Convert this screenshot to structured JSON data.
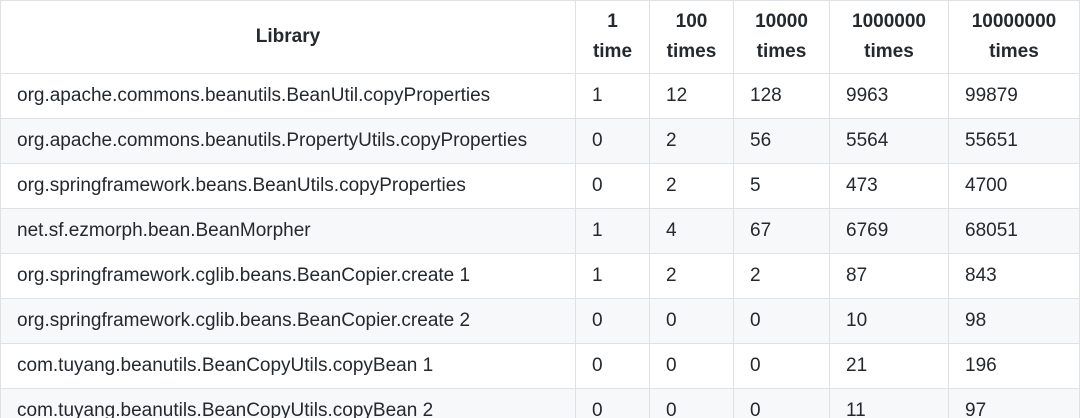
{
  "table": {
    "headers": [
      {
        "line1": "Library",
        "line2": ""
      },
      {
        "line1": "1",
        "line2": "time"
      },
      {
        "line1": "100",
        "line2": "times"
      },
      {
        "line1": "10000",
        "line2": "times"
      },
      {
        "line1": "1000000",
        "line2": "times"
      },
      {
        "line1": "10000000",
        "line2": "times"
      }
    ],
    "rows": [
      [
        "org.apache.commons.beanutils.BeanUtil.copyProperties",
        "1",
        "12",
        "128",
        "9963",
        "99879"
      ],
      [
        "org.apache.commons.beanutils.PropertyUtils.copyProperties",
        "0",
        "2",
        "56",
        "5564",
        "55651"
      ],
      [
        "org.springframework.beans.BeanUtils.copyProperties",
        "0",
        "2",
        "5",
        "473",
        "4700"
      ],
      [
        "net.sf.ezmorph.bean.BeanMorpher",
        "1",
        "4",
        "67",
        "6769",
        "68051"
      ],
      [
        "org.springframework.cglib.beans.BeanCopier.create 1",
        "1",
        "2",
        "2",
        "87",
        "843"
      ],
      [
        "org.springframework.cglib.beans.BeanCopier.create 2",
        "0",
        "0",
        "0",
        "10",
        "98"
      ],
      [
        "com.tuyang.beanutils.BeanCopyUtils.copyBean 1",
        "0",
        "0",
        "0",
        "21",
        "196"
      ],
      [
        "com.tuyang.beanutils.BeanCopyUtils.copyBean 2",
        "0",
        "0",
        "0",
        "11",
        "97"
      ]
    ]
  }
}
